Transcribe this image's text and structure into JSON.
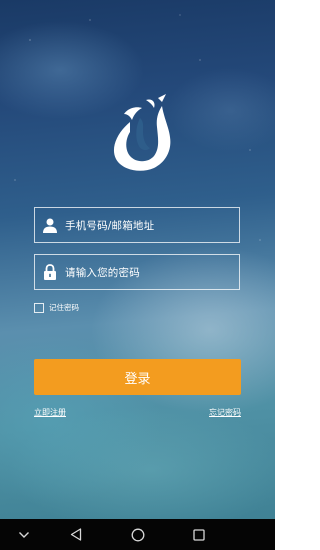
{
  "login_form": {
    "phone_placeholder": "手机号码/邮箱地址",
    "password_placeholder": "请输入您的密码",
    "remember_label": "记住密码",
    "login_label": "登录",
    "register_link": "立即注册",
    "forgot_link": "忘记密码"
  },
  "icons": {
    "logo": "phoenix-logo-icon",
    "phone_field": "user-icon",
    "password_field": "lock-icon"
  },
  "nav_bar": {
    "buttons": [
      "chevron-down-icon",
      "back-icon",
      "home-icon",
      "recent-apps-icon"
    ]
  },
  "colors": {
    "accent": "#f39c1f",
    "text": "#ffffff",
    "nav_bar": "#050505"
  }
}
